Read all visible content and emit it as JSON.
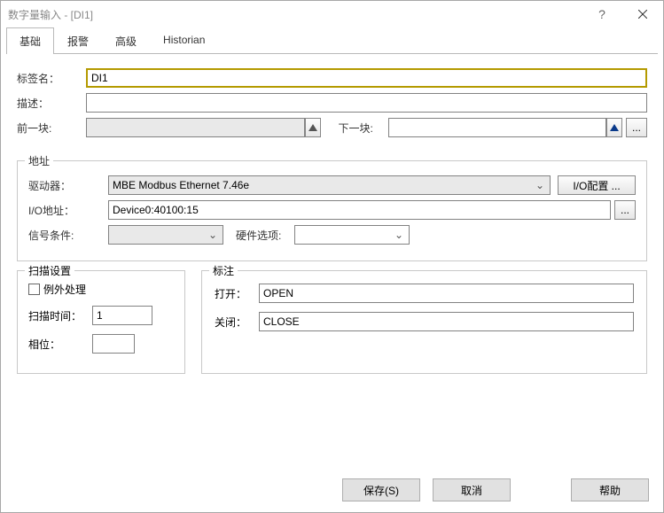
{
  "window": {
    "title": "数字量输入 - [DI1]"
  },
  "tabs": {
    "basic": "基础",
    "alarm": "报警",
    "advanced": "高级",
    "historian": "Historian"
  },
  "fields": {
    "tagname_label": "标签名：",
    "tagname_value": "DI1",
    "desc_label": "描述：",
    "desc_value": "",
    "prev_label": "前一块:",
    "prev_value": "",
    "next_label": "下一块:",
    "next_value": ""
  },
  "address": {
    "legend": "地址",
    "driver_label": "驱动器：",
    "driver_value": "MBE    Modbus Ethernet 7.46e",
    "ioconfig": "I/O配置 ...",
    "ioaddr_label": "I/O地址：",
    "ioaddr_value": "Device0:40100:15",
    "signal_label": "信号条件:",
    "signal_value": "",
    "hwopt_label": "硬件选项:",
    "hwopt_value": ""
  },
  "scan": {
    "legend": "扫描设置",
    "exception_label": "例外处理",
    "scantime_label": "扫描时间：",
    "scantime_value": "1",
    "phase_label": "相位：",
    "phase_value": ""
  },
  "labels": {
    "legend": "标注",
    "open_label": "打开：",
    "open_value": "OPEN",
    "close_label": "关闭：",
    "close_value": "CLOSE"
  },
  "footer": {
    "save": "保存(S)",
    "cancel": "取消",
    "help": "帮助"
  }
}
